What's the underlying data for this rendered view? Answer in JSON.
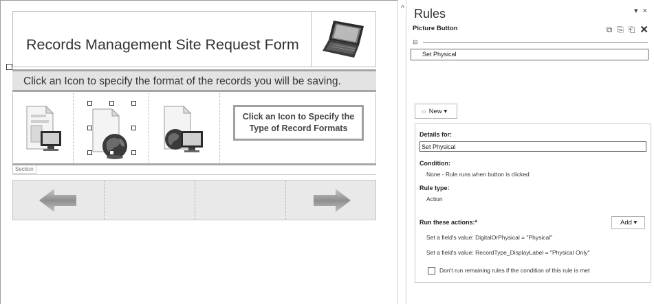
{
  "form": {
    "title": "Records Management Site Request Form",
    "instruction": "Click an Icon to specify the format of the records you will be saving.",
    "callout": "Click an Icon to Specify the Type of Record Formats",
    "section_label": "Section"
  },
  "rules_pane": {
    "title": "Rules",
    "header_controls": "▾ ×",
    "control_name": "Picture Button",
    "toolbar_icons": [
      "copy-icon",
      "paste-icon",
      "paste-rule-icon",
      "delete-icon"
    ],
    "rules": [
      "Set Physical"
    ],
    "new_button": "New",
    "details_label": "Details for:",
    "rule_name": "Set Physical",
    "condition_label": "Condition:",
    "condition_value": "None - Rule runs when button is clicked",
    "rule_type_label": "Rule type:",
    "rule_type_value": "Action",
    "actions_label": "Run these actions:",
    "actions_required": "*",
    "add_button": "Add",
    "actions": [
      "Set a field's value: DigitalOrPhysical = \"Physical\"",
      "Set a field's value: RecordType_DisplayLabel = \"Physical Only\""
    ],
    "stop_rules_label": "Don't run remaining rules if the condition of this rule is met"
  },
  "colors": {
    "instruction_bg": "#e3e3e3",
    "nav_row_bg": "#e9e9e9",
    "arrow_gray": "#9a9a9a"
  }
}
